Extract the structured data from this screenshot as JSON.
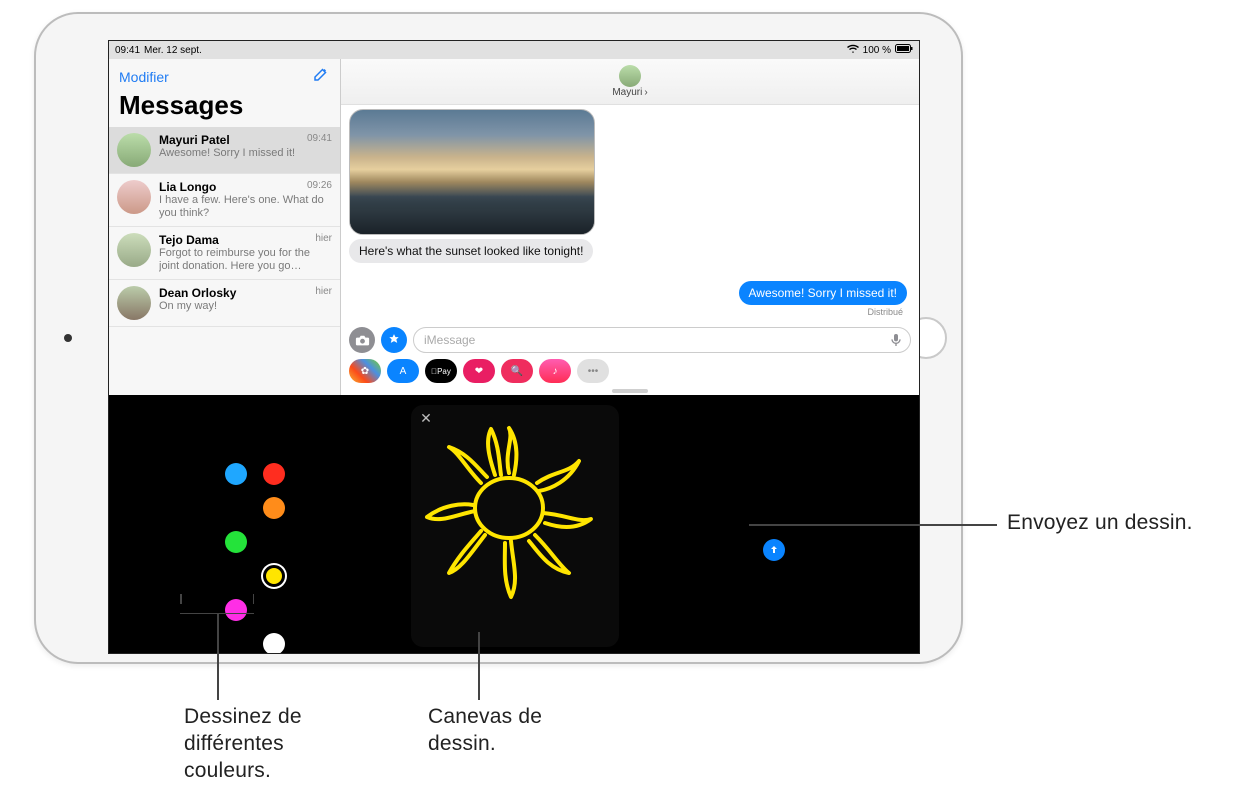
{
  "statusbar": {
    "time": "09:41",
    "date": "Mer. 12 sept.",
    "battery": "100 %"
  },
  "sidebar": {
    "edit_label": "Modifier",
    "title": "Messages",
    "conversations": [
      {
        "name": "Mayuri Patel",
        "time": "09:41",
        "preview": "Awesome! Sorry I missed it!"
      },
      {
        "name": "Lia Longo",
        "time": "09:26",
        "preview": "I have a few. Here's one. What do you think?"
      },
      {
        "name": "Tejo Dama",
        "time": "hier",
        "preview": "Forgot to reimburse you for the joint donation. Here you go…"
      },
      {
        "name": "Dean Orlosky",
        "time": "hier",
        "preview": "On my way!"
      }
    ]
  },
  "chat": {
    "contact": "Mayuri",
    "incoming_text": "Here's what the sunset looked like tonight!",
    "outgoing_text": "Awesome! Sorry I missed it!",
    "delivered_label": "Distribué",
    "input_placeholder": "iMessage",
    "apps": {
      "pay_label": "Pay"
    }
  },
  "drawer": {
    "colors": [
      {
        "name": "blue",
        "hex": "#1fa7ff"
      },
      {
        "name": "red",
        "hex": "#ff2d1f"
      },
      {
        "name": "green",
        "hex": "#24e33a"
      },
      {
        "name": "orange",
        "hex": "#ff8c1a"
      },
      {
        "name": "magenta",
        "hex": "#ff2ee6"
      },
      {
        "name": "yellow",
        "hex": "#ffe500",
        "selected": true
      },
      {
        "name": "white",
        "hex": "#ffffff"
      }
    ]
  },
  "callouts": {
    "send": "Envoyez un dessin.",
    "colors_l1": "Dessinez de",
    "colors_l2": "différentes",
    "colors_l3": "couleurs.",
    "canvas_l1": "Canevas de",
    "canvas_l2": "dessin."
  }
}
